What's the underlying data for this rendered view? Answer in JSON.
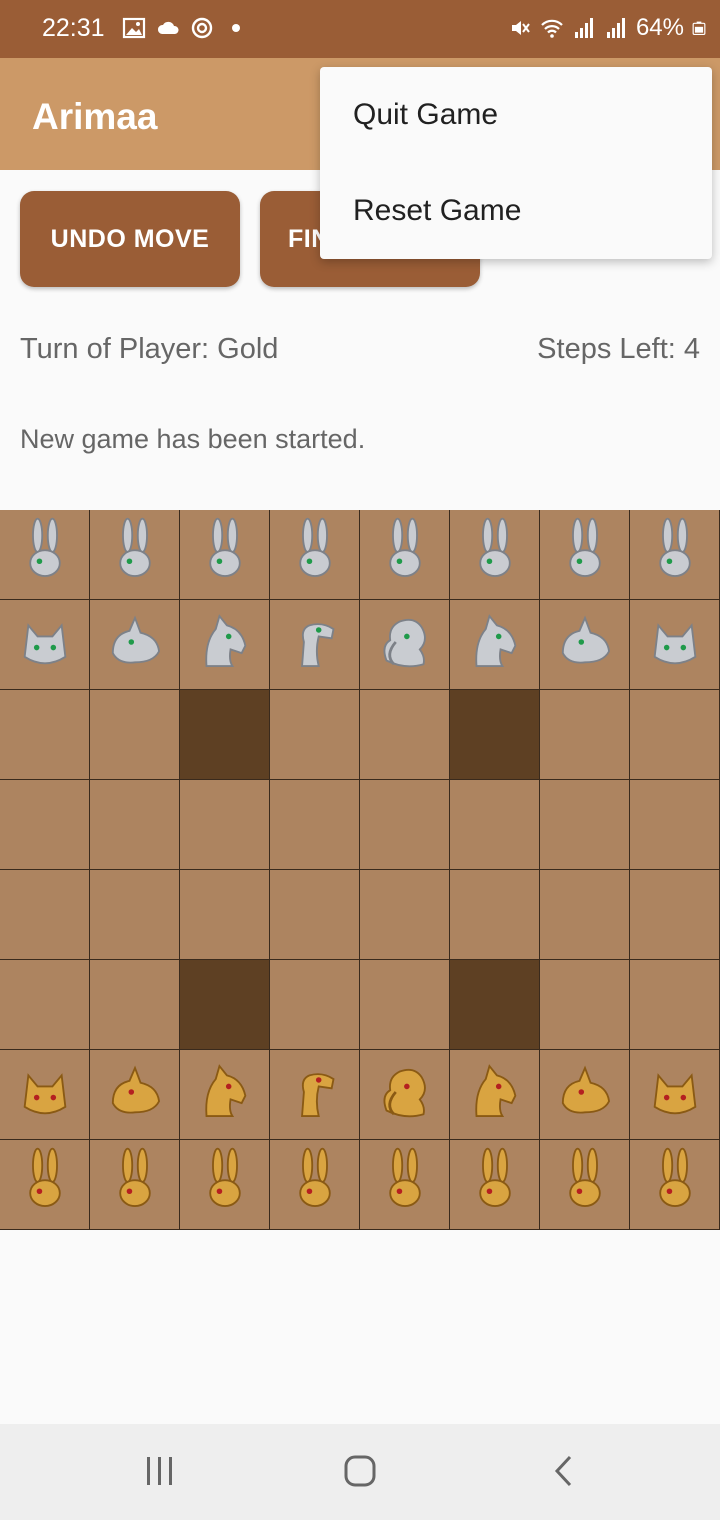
{
  "status_bar": {
    "time": "22:31",
    "battery": "64%",
    "icons_left": [
      "image-icon",
      "cloud-icon",
      "sync-icon",
      "dot-icon"
    ],
    "icons_right": [
      "mute-icon",
      "wifi-icon",
      "signal-icon",
      "signal-icon",
      "battery-icon"
    ]
  },
  "app": {
    "title": "Arimaa"
  },
  "buttons": {
    "undo": "UNDO MOVE",
    "finish": "FINISH MOVE"
  },
  "status": {
    "turn": "Turn of Player: Gold",
    "steps": "Steps Left: 4",
    "message": "New game has been started."
  },
  "menu": {
    "items": [
      "Quit Game",
      "Reset Game"
    ]
  },
  "board": {
    "size": 8,
    "traps": [
      [
        2,
        2
      ],
      [
        2,
        5
      ],
      [
        5,
        2
      ],
      [
        5,
        5
      ]
    ],
    "rows": [
      [
        "sR",
        "sR",
        "sR",
        "sR",
        "sR",
        "sR",
        "sR",
        "sR"
      ],
      [
        "sC",
        "sD",
        "sH",
        "sM",
        "sE",
        "sH",
        "sD",
        "sC"
      ],
      [
        "",
        "",
        "",
        "",
        "",
        "",
        "",
        ""
      ],
      [
        "",
        "",
        "",
        "",
        "",
        "",
        "",
        ""
      ],
      [
        "",
        "",
        "",
        "",
        "",
        "",
        "",
        ""
      ],
      [
        "",
        "",
        "",
        "",
        "",
        "",
        "",
        ""
      ],
      [
        "gC",
        "gD",
        "gH",
        "gM",
        "gE",
        "gH",
        "gD",
        "gC"
      ],
      [
        "gR",
        "gR",
        "gR",
        "gR",
        "gR",
        "gR",
        "gR",
        "gR"
      ]
    ],
    "piece_names": {
      "R": "rabbit",
      "C": "cat",
      "D": "dog",
      "H": "horse",
      "M": "camel",
      "E": "elephant"
    }
  },
  "colors": {
    "status_bar": "#9a5d36",
    "app_bar": "#cc9967",
    "button": "#9a5d36",
    "square": "#ad8460",
    "trap": "#5e4023",
    "silver": "#c9ccd1",
    "gold": "#d9a441"
  },
  "nav": {
    "icons": [
      "recent-apps-icon",
      "home-icon",
      "back-icon"
    ]
  }
}
